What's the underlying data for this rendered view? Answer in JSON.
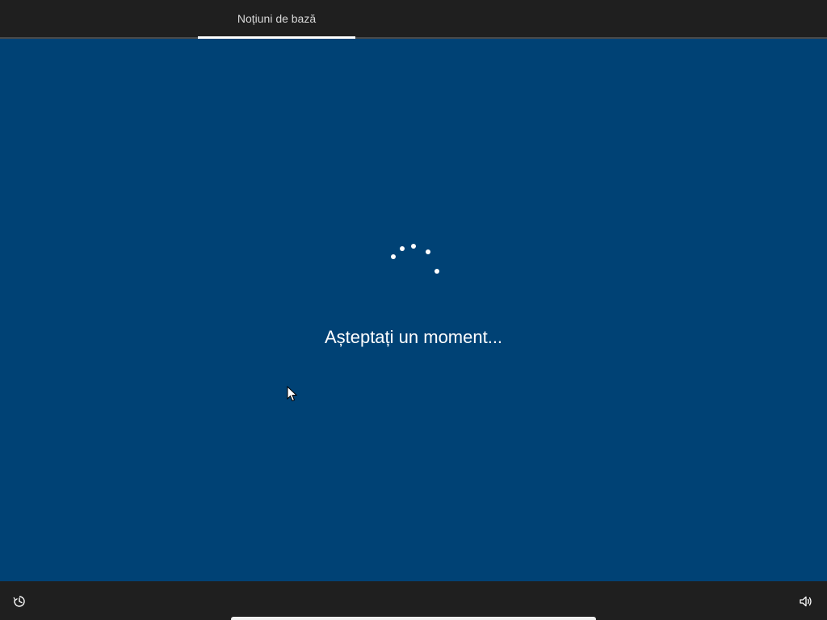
{
  "header": {
    "tabs": [
      {
        "label": "Noțiuni de bază",
        "active": true
      }
    ]
  },
  "main": {
    "status_text": "Așteptați un moment...",
    "spinner_icon": "loading-spinner-icon"
  },
  "footer": {
    "left_icon": "accessibility-icon",
    "right_icon": "volume-icon"
  },
  "colors": {
    "background": "#004275",
    "bar": "#1f1f1f",
    "text": "#ffffff",
    "tab_text": "#d8d8d8"
  }
}
